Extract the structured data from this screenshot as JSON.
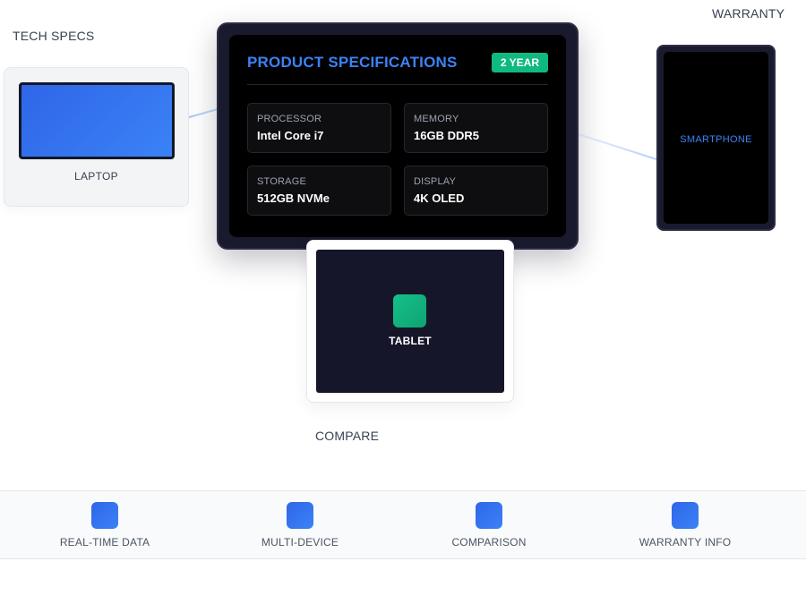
{
  "labels": {
    "tech_specs": "TECH SPECS",
    "warranty": "WARRANTY",
    "compare": "COMPARE"
  },
  "devices": {
    "laptop": "LAPTOP",
    "smartphone": "SMARTPHONE",
    "tablet": "TABLET"
  },
  "spec_panel": {
    "title": "PRODUCT SPECIFICATIONS",
    "badge": "2 YEAR",
    "specs": [
      {
        "label": "PROCESSOR",
        "value": "Intel Core i7"
      },
      {
        "label": "MEMORY",
        "value": "16GB DDR5"
      },
      {
        "label": "STORAGE",
        "value": "512GB NVMe"
      },
      {
        "label": "DISPLAY",
        "value": "4K OLED"
      }
    ]
  },
  "features": [
    {
      "label": "REAL-TIME DATA",
      "icon": "data-icon"
    },
    {
      "label": "MULTI-DEVICE",
      "icon": "devices-icon"
    },
    {
      "label": "COMPARISON",
      "icon": "compare-icon"
    },
    {
      "label": "WARRANTY INFO",
      "icon": "warranty-icon"
    }
  ],
  "colors": {
    "accent": "#3b82f6",
    "success": "#10b981",
    "dark_frame": "#1a1a2e"
  }
}
